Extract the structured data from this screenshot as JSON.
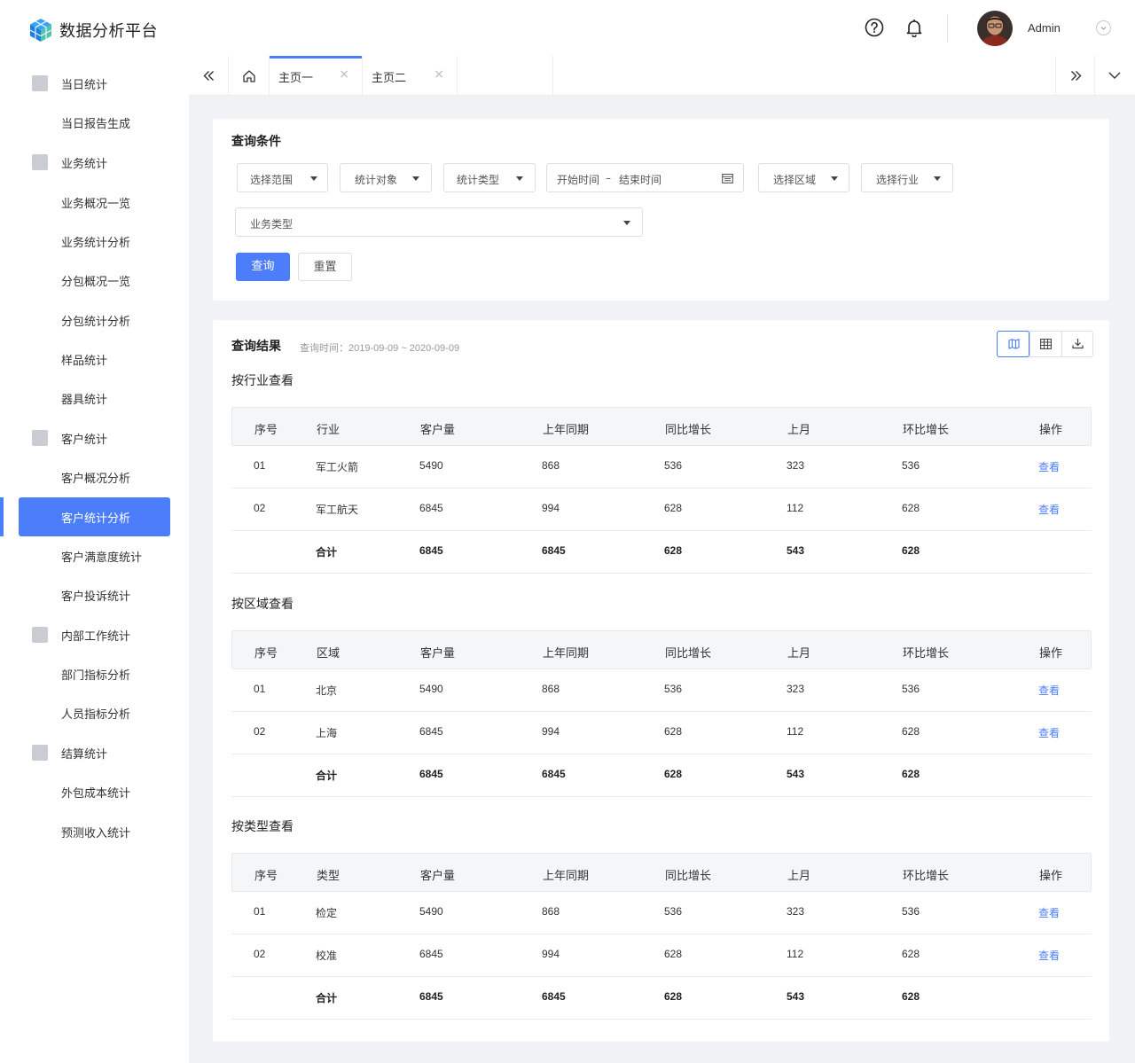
{
  "app": {
    "title": "数据分析平台",
    "user": "Admin"
  },
  "colors": {
    "primary": "#4c7dfa",
    "sidebar_icon": "#c9ccd3",
    "page_bg": "#f0f2f5"
  },
  "header": {
    "icons": [
      "help-circle-icon",
      "bell-icon",
      "chevron-down-circle-icon"
    ]
  },
  "sidebar": {
    "items": [
      {
        "label": "当日统计",
        "group": true,
        "icon": "calendar-check-icon"
      },
      {
        "label": "当日报告生成"
      },
      {
        "label": "业务统计",
        "group": true,
        "icon": "bar-chart-icon"
      },
      {
        "label": "业务概况一览"
      },
      {
        "label": "业务统计分析"
      },
      {
        "label": "分包概况一览"
      },
      {
        "label": "分包统计分析"
      },
      {
        "label": "样品统计"
      },
      {
        "label": "器具统计"
      },
      {
        "label": "客户统计",
        "group": true,
        "icon": "id-card-icon"
      },
      {
        "label": "客户概况分析"
      },
      {
        "label": "客户统计分析",
        "active": true
      },
      {
        "label": "客户满意度统计"
      },
      {
        "label": "客户投诉统计"
      },
      {
        "label": "内部工作统计",
        "group": true,
        "icon": "line-chart-icon"
      },
      {
        "label": "部门指标分析"
      },
      {
        "label": "人员指标分析"
      },
      {
        "label": "结算统计",
        "group": true,
        "icon": "yen-icon"
      },
      {
        "label": "外包成本统计"
      },
      {
        "label": "预测收入统计"
      }
    ]
  },
  "tabs": [
    {
      "label": "主页一",
      "active": true
    },
    {
      "label": "主页二"
    }
  ],
  "query": {
    "title": "查询条件",
    "selects": [
      "选择范围",
      "统计对象",
      "统计类型"
    ],
    "date_start": "开始时间",
    "date_sep": "–",
    "date_end": "结束时间",
    "selects2": [
      "选择区域",
      "选择行业"
    ],
    "business_type": "业务类型",
    "btn_query": "查询",
    "btn_reset": "重置"
  },
  "result": {
    "title": "查询结果",
    "time": "查询时间：2019-09-09 ~ 2020-09-09",
    "sections": [
      {
        "title": "按行业查看",
        "col2": "行业",
        "rows": [
          {
            "no": "01",
            "name": "军工火箭",
            "customers": "5490",
            "last_year": "868",
            "yoy": "536",
            "last_month": "323",
            "mom": "536",
            "action": "查看"
          },
          {
            "no": "02",
            "name": "军工航天",
            "customers": "6845",
            "last_year": "994",
            "yoy": "628",
            "last_month": "112",
            "mom": "628",
            "action": "查看"
          }
        ],
        "total": {
          "label": "合计",
          "customers": "6845",
          "last_year": "6845",
          "yoy": "628",
          "last_month": "543",
          "mom": "628"
        }
      },
      {
        "title": "按区域查看",
        "col2": "区域",
        "rows": [
          {
            "no": "01",
            "name": "北京",
            "customers": "5490",
            "last_year": "868",
            "yoy": "536",
            "last_month": "323",
            "mom": "536",
            "action": "查看"
          },
          {
            "no": "02",
            "name": "上海",
            "customers": "6845",
            "last_year": "994",
            "yoy": "628",
            "last_month": "112",
            "mom": "628",
            "action": "查看"
          }
        ],
        "total": {
          "label": "合计",
          "customers": "6845",
          "last_year": "6845",
          "yoy": "628",
          "last_month": "543",
          "mom": "628"
        }
      },
      {
        "title": "按类型查看",
        "col2": "类型",
        "rows": [
          {
            "no": "01",
            "name": "检定",
            "customers": "5490",
            "last_year": "868",
            "yoy": "536",
            "last_month": "323",
            "mom": "536",
            "action": "查看"
          },
          {
            "no": "02",
            "name": "校准",
            "customers": "6845",
            "last_year": "994",
            "yoy": "628",
            "last_month": "112",
            "mom": "628",
            "action": "查看"
          }
        ],
        "total": {
          "label": "合计",
          "customers": "6845",
          "last_year": "6845",
          "yoy": "628",
          "last_month": "543",
          "mom": "628"
        }
      }
    ],
    "columns": {
      "no": "序号",
      "customers": "客户量",
      "last_year": "上年同期",
      "yoy": "同比增长",
      "last_month": "上月",
      "mom": "环比增长",
      "action": "操作"
    }
  }
}
